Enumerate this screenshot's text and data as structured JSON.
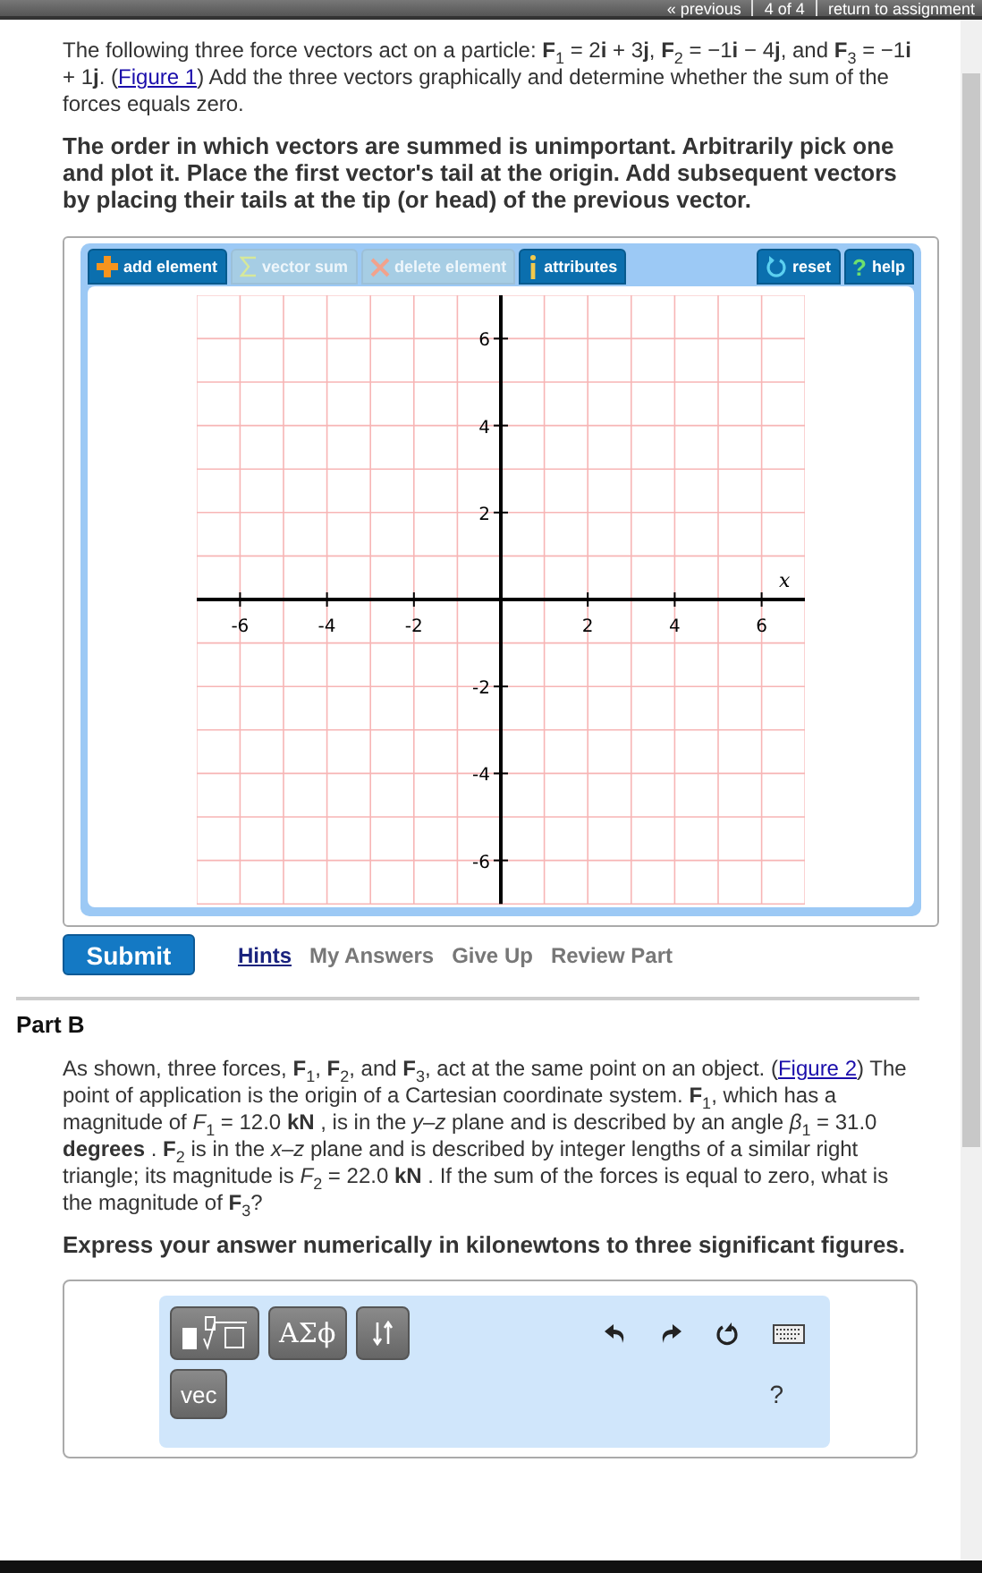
{
  "nav": {
    "links": [
      {
        "label": "« previous"
      },
      {
        "label": "4 of 4"
      },
      {
        "label": "return to assignment"
      }
    ]
  },
  "part_a": {
    "intro": "The following three force vectors act on a particle: **F**$_{1}$ = 2**i** + 3**j**, **F**$_{2}$ = −1**i** − 4**j**, and **F**$_{3}$ = −1**i** + 1**j**. (",
    "figure_link": "Figure 1",
    "intro_end": ") Add the three vectors graphically and determine whether the sum of the forces equals zero.",
    "instruction": "The order in which vectors are summed is unimportant. Arbitrarily pick one and plot it. Place the first vector's tail at the origin. Add subsequent vectors by placing their tails at the tip (or head) of the previous vector.",
    "tools": [
      {
        "kind": "add",
        "label": "add element",
        "disabled": false
      },
      {
        "kind": "sum",
        "label": "vector sum",
        "disabled": true
      },
      {
        "kind": "delete",
        "label": "delete element",
        "disabled": true
      },
      {
        "kind": "info",
        "label": "attributes",
        "disabled": false
      }
    ],
    "side_tools": [
      {
        "kind": "reset",
        "label": "reset"
      },
      {
        "kind": "help",
        "label": "help",
        "icon": "?"
      }
    ],
    "graph": {
      "x_ticks": [
        "-6",
        "-4",
        "-2",
        "2",
        "4",
        "6"
      ],
      "y_ticks": [
        "6",
        "4",
        "2",
        "-2",
        "-4",
        "-6"
      ],
      "x_axis_label": "x"
    },
    "submit": "Submit",
    "actions": [
      {
        "label": "Hints",
        "disabled": false
      },
      {
        "label": "My Answers",
        "disabled": true
      },
      {
        "label": "Give Up",
        "disabled": true
      },
      {
        "label": "Review Part",
        "disabled": true
      }
    ]
  },
  "part_b": {
    "title": "Part B",
    "text_start": "As shown, three forces, **F**$_{1}$, **F**$_{2}$, and **F**$_{3}$, act at the same point on an object. (",
    "figure_link": "Figure 2",
    "text_end": ") The point of application is the origin of a Cartesian coordinate system. **F**$_{1}$, which has a magnitude of *F*$_{1}$ = 12.0 **kN** , is in the *y*–*z* plane and is described by an angle *β*$_{1}$ = 31.0 **degrees** .  **F**$_{2}$ is in the *x*–*z* plane and is described by integer lengths of a similar right triangle; its magnitude is *F*$_{2}$ = 22.0 **kN** . If the sum of the forces is equal to zero, what is the magnitude of **F**$_{3}$?",
    "instruction": "Express your answer numerically in kilonewtons to three significant figures.",
    "editor": {
      "buttons": [
        {
          "kind": "templates"
        },
        {
          "kind": "text",
          "label": "ΑΣϕ"
        },
        {
          "kind": "arrows"
        }
      ],
      "vec": "vec",
      "help": "?"
    }
  }
}
